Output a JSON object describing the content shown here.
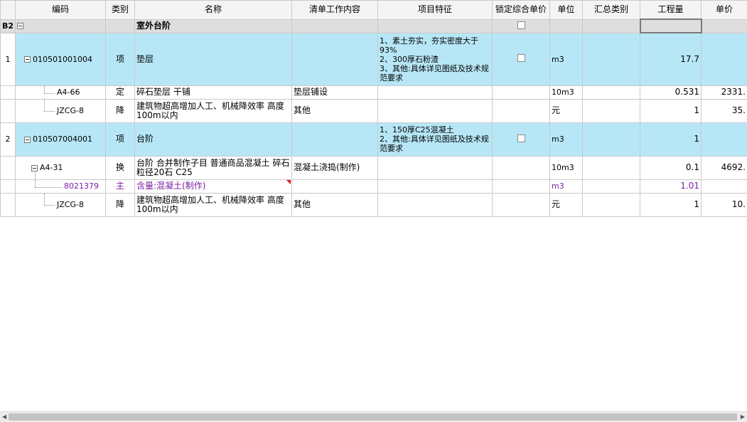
{
  "headers": {
    "code": "编码",
    "category": "类别",
    "name": "名称",
    "work_content": "清单工作内容",
    "features": "项目特征",
    "lock_price": "锁定综合单价",
    "unit": "单位",
    "summary_category": "汇总类别",
    "quantity": "工程量",
    "unit_price": "单价"
  },
  "section": {
    "rownum": "B2",
    "name": "室外台阶"
  },
  "rows": [
    {
      "rownum": "1",
      "code": "010501001004",
      "category": "项",
      "name": "垫层",
      "work_content": "",
      "features": [
        "1、素土夯实，夯实密度大于93%",
        "2、300厚石粉渣",
        "3、其他:具体详见图纸及技术规范要求"
      ],
      "unit": "m3",
      "quantity": "17.7",
      "unit_price": ""
    },
    {
      "code": "A4-66",
      "category": "定",
      "name": "碎石垫层 干铺",
      "work_content": "垫层铺设",
      "unit": "10m3",
      "quantity": "0.531",
      "unit_price": "2331."
    },
    {
      "code": "JZCG-8",
      "category": "降",
      "name": "建筑物超高增加人工、机械降效率 高度100m以内",
      "work_content": "其他",
      "unit": "元",
      "quantity": "1",
      "unit_price": "35."
    },
    {
      "rownum": "2",
      "code": "010507004001",
      "category": "项",
      "name": "台阶",
      "work_content": "",
      "features": [
        "1、150厚C25混凝土",
        "2、其他:具体详见图纸及技术规范要求"
      ],
      "unit": "m3",
      "quantity": "1",
      "unit_price": ""
    },
    {
      "code": "A4-31",
      "category": "换",
      "name": "台阶  合并制作子目 普通商品混凝土 碎石粒径20石 C25",
      "work_content": "混凝土浇捣(制作)",
      "unit": "10m3",
      "quantity": "0.1",
      "unit_price": "4692."
    },
    {
      "code": "8021379",
      "category": "主",
      "name": "含量:混凝土(制作)",
      "work_content": "",
      "unit": "m3",
      "quantity": "1.01",
      "unit_price": ""
    },
    {
      "code": "JZCG-8",
      "category": "降",
      "name": "建筑物超高增加人工、机械降效率 高度100m以内",
      "work_content": "其他",
      "unit": "元",
      "quantity": "1",
      "unit_price": "10."
    }
  ],
  "colors": {
    "item_row": "#b7e7f7",
    "section_row": "#dedede",
    "quantity_header": "#fde98f",
    "material_text": "#7a1fa2"
  }
}
